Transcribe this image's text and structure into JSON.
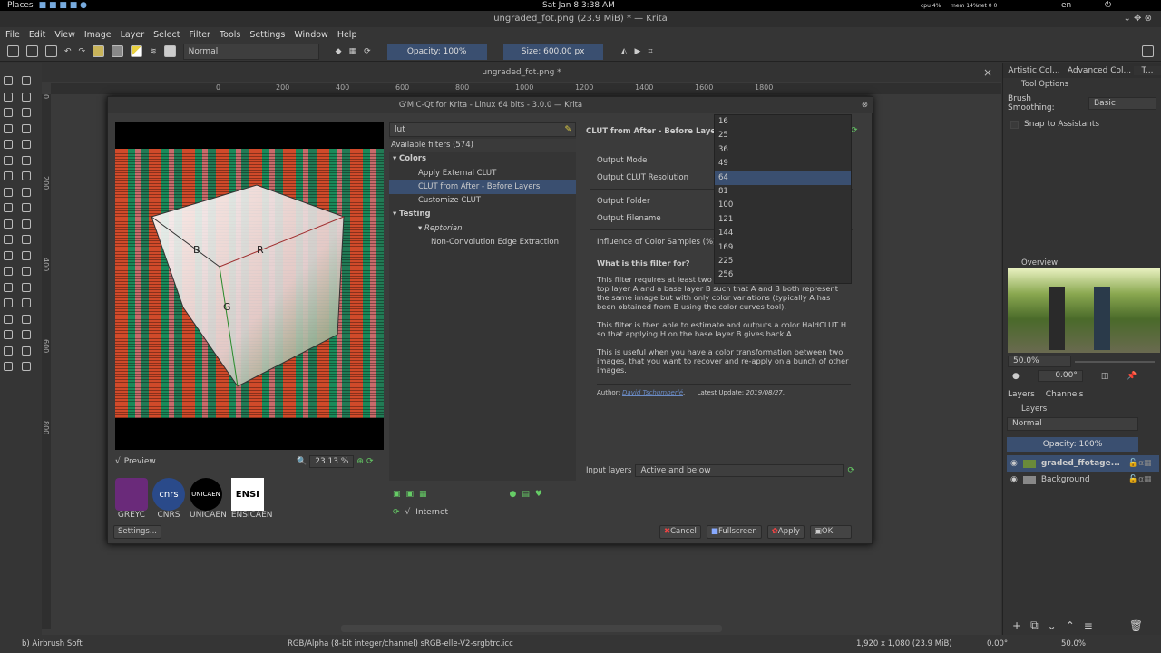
{
  "system_bar": {
    "places": "Places",
    "datetime": "Sat Jan 8   3:38 AM",
    "cpu": "cpu 4%",
    "mem": "mem 14%",
    "net": "net 0 0",
    "lang": "en"
  },
  "window": {
    "title": "ungraded_fot.png (23.9 MiB)  * — Krita"
  },
  "menu": [
    "File",
    "Edit",
    "View",
    "Image",
    "Layer",
    "Select",
    "Filter",
    "Tools",
    "Settings",
    "Window",
    "Help"
  ],
  "toolbar": {
    "blend_mode": "Normal",
    "opacity": "Opacity: 100%",
    "size": "Size: 600.00 px"
  },
  "canvas": {
    "doc_tab": "ungraded_fot.png *",
    "hruler": [
      "0",
      "200",
      "400",
      "600",
      "800",
      "1000",
      "1200",
      "1400",
      "1600",
      "1800"
    ],
    "vruler": [
      "0",
      "200",
      "400",
      "600",
      "800"
    ]
  },
  "dialog": {
    "title": "G'MIC-Qt for Krita - Linux 64 bits - 3.0.0 — Krita",
    "preview_label": "Preview",
    "zoom": "23.13 %",
    "cube_labels": [
      "B",
      "R",
      "G"
    ],
    "logos": [
      "GREYC",
      "CNRS",
      "UNICAEN",
      "ENSICAEN"
    ],
    "settings": "Settings...",
    "search": "lut",
    "available": "Available filters (574)",
    "tree": [
      {
        "label": "Colors",
        "level": 0,
        "bold": true
      },
      {
        "label": "Apply External CLUT",
        "level": 1
      },
      {
        "label": "CLUT from After - Before Layers",
        "level": 1,
        "selected": true
      },
      {
        "label": "Customize CLUT",
        "level": 1
      },
      {
        "label": "Testing",
        "level": 0,
        "bold": true
      },
      {
        "label": "Reptorian",
        "level": 1,
        "italic": true
      },
      {
        "label": "Non-Convolution Edge Extraction",
        "level": 2
      }
    ],
    "internet": "Internet",
    "filter_title": "CLUT from After - Before Layers",
    "params": [
      "Output Mode",
      "Output CLUT Resolution",
      "Output Folder",
      "Output Filename",
      "Influence of Color Samples (%)"
    ],
    "dropdown_options": [
      "16",
      "25",
      "36",
      "49",
      "64",
      "81",
      "100",
      "121",
      "144",
      "169",
      "225",
      "256"
    ],
    "dropdown_selected": "64",
    "help_title": "What is this filter for?",
    "help_p1": "This filter requires at least two i... It assumes you have an input top layer A and a base layer B such that A and B both represent the same image but with only color variations (typically A has been obtained from B using the color curves tool).",
    "help_p2": "This filter is then able to estimate and outputs a color HaldCLUT H so that applying H on the base layer B gives back A.",
    "help_p3": "This is useful when you have a color transformation between two images, that you want to recover and re-apply on a bunch of other images.",
    "author_label": "Author:",
    "author": "David Tschumperlé",
    "update_label": "Latest Update:",
    "update": "2019/08/27",
    "input_layers_label": "Input layers",
    "input_layers": "Active and below",
    "buttons": {
      "cancel": "Cancel",
      "fullscreen": "Fullscreen",
      "apply": "Apply",
      "ok": "OK"
    }
  },
  "dock": {
    "tabs": [
      "Artistic Col...",
      "Advanced Col...",
      "T..."
    ],
    "tool_options": "Tool Options",
    "brush_smoothing_label": "Brush Smoothing:",
    "brush_smoothing": "Basic",
    "snap": "Snap to Assistants",
    "overview": "Overview",
    "overview_zoom": "50.0%",
    "rotation": "0.00°",
    "layer_tabs": [
      "Layers",
      "Channels"
    ],
    "layers_title": "Layers",
    "layer_blend": "Normal",
    "layer_opacity": "Opacity:  100%",
    "layers": [
      {
        "name": "graded_ffotage...",
        "selected": true
      },
      {
        "name": "Background",
        "selected": false
      }
    ]
  },
  "status": {
    "brush": "b) Airbrush Soft",
    "color": "RGB/Alpha (8-bit integer/channel)  sRGB-elle-V2-srgbtrc.icc",
    "dims": "1,920 x 1,080 (23.9 MiB)",
    "rotation": "0.00°",
    "zoom": "50.0%"
  },
  "colors": {
    "accent": "#3a4f70",
    "link": "#6b8cc7"
  }
}
